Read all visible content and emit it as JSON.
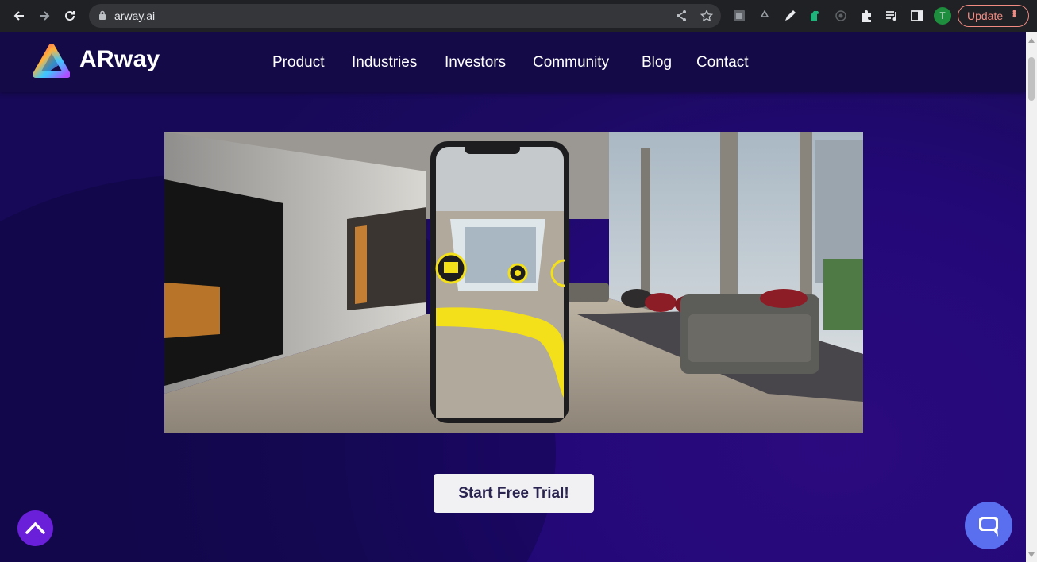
{
  "browser": {
    "url": "arway.ai",
    "update_label": "Update",
    "profile_initial": "T",
    "icons": [
      "back-icon",
      "forward-icon",
      "reload-icon",
      "lock-icon",
      "share-icon",
      "star-icon",
      "extension-icon",
      "puzzle-icon",
      "media-icon",
      "sidepanel-icon",
      "menu-icon"
    ]
  },
  "site": {
    "brand": "ARway",
    "nav": [
      "Product",
      "Industries",
      "Investors",
      "Community",
      "Blog",
      "Contact"
    ],
    "cta": "Start Free Trial!",
    "colors": {
      "background": "#1c0a62",
      "navbar": "#140a48",
      "accent": "#6a1fd8",
      "chat": "#5a6ef0",
      "ar_path": "#f5e11a"
    }
  }
}
